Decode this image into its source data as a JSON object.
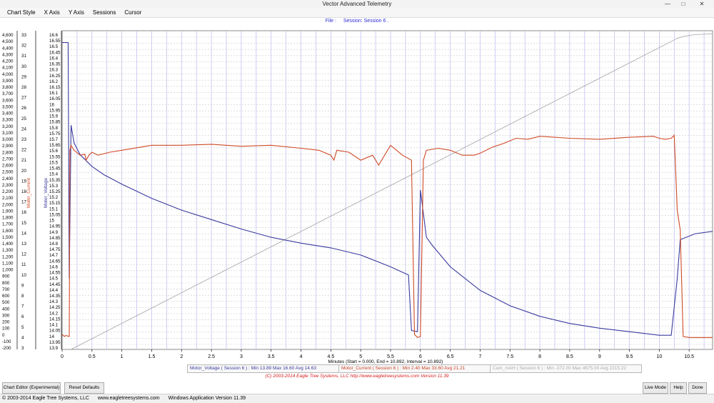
{
  "window": {
    "title": "Vector Advanced Telemetry"
  },
  "menu": [
    "Chart Style",
    "X Axis",
    "Y Axis",
    "Sessions",
    "Cursor"
  ],
  "file_bar": {
    "file": "File :",
    "session": "Session: Session 6 ."
  },
  "colors": {
    "voltage": "#3a3a9e",
    "current": "#cf4a26",
    "cum_mah": "#a0a0a0",
    "vgrid": "#b9b9f0",
    "hgrid": "#c9c9c9"
  },
  "chart_data": {
    "type": "line",
    "xlabel": "Minutes (Start = 0.000, End = 10.892, Interval = 10.892)",
    "xlim": [
      0,
      10.892
    ],
    "x_ticks": [
      0,
      0.5,
      1,
      1.5,
      2,
      2.5,
      3,
      3.5,
      4,
      4.5,
      5,
      5.5,
      6,
      6.5,
      7,
      7.5,
      8,
      8.5,
      9,
      9.5,
      10,
      10.5
    ],
    "x_tick_labels": [
      "0",
      "0.5",
      "1",
      "1.5",
      "2",
      "2.5",
      "3",
      "3.5",
      "4",
      "4.5",
      "5",
      "5.5",
      "6",
      "6.5",
      "7",
      "7.5",
      "8",
      "8.5",
      "9",
      "9.5",
      "10",
      "10.5"
    ],
    "y_axes": [
      {
        "name": "Cum_mAH",
        "min": -300,
        "max": 4700,
        "step": 100,
        "ticks": [
          "4,600",
          "4,500",
          "4,400",
          "4,300",
          "4,200",
          "4,100",
          "4,000",
          "3,900",
          "3,800",
          "3,700",
          "3,600",
          "3,500",
          "3,400",
          "3,300",
          "3,200",
          "3,100",
          "3,000",
          "2,900",
          "2,800",
          "2,700",
          "2,600",
          "2,500",
          "2,400",
          "2,300",
          "2,200",
          "2,100",
          "2,000",
          "1,900",
          "1,800",
          "1,700",
          "1,600",
          "1,500",
          "1,400",
          "1,300",
          "1,200",
          "1,100",
          "1,000",
          "900",
          "800",
          "700",
          "600",
          "500",
          "400",
          "300",
          "200",
          "100",
          "0",
          "-100",
          "-200"
        ]
      },
      {
        "name": "Motor_Current",
        "min": 2,
        "max": 34,
        "step": 1,
        "label": "Motor_Current",
        "ticks": [
          "33",
          "32",
          "31",
          "30",
          "29",
          "28",
          "27",
          "26",
          "25",
          "24",
          "23",
          "22",
          "21",
          "20",
          "19",
          "18",
          "17",
          "16",
          "15",
          "14",
          "13",
          "12",
          "11",
          "10",
          "9",
          "8",
          "7",
          "6",
          "5",
          "4",
          "3"
        ]
      },
      {
        "name": "Motor_Voltage",
        "min": 13.9,
        "max": 16.6,
        "step": 0.05,
        "label": "Motor_Voltage",
        "ticks": [
          "16.6",
          "16.55",
          "16.5",
          "16.45",
          "16.4",
          "16.35",
          "16.3",
          "16.25",
          "16.2",
          "16.15",
          "16.1",
          "16.05",
          "16",
          "15.95",
          "15.9",
          "15.85",
          "15.8",
          "15.75",
          "15.7",
          "15.65",
          "15.6",
          "15.55",
          "15.5",
          "15.45",
          "15.4",
          "15.35",
          "15.3",
          "15.25",
          "15.2",
          "15.15",
          "15.1",
          "15.05",
          "15",
          "14.95",
          "14.9",
          "14.85",
          "14.8",
          "14.75",
          "14.7",
          "14.65",
          "14.6",
          "14.55",
          "14.5",
          "14.45",
          "14.4",
          "14.35",
          "14.3",
          "14.25",
          "14.2",
          "14.15",
          "14.1",
          "14.05",
          "14",
          "13.95",
          "13.9"
        ]
      }
    ],
    "series": [
      {
        "name": "Motor_Current",
        "axis": 1,
        "x": [
          0,
          0.04,
          0.06,
          0.12,
          0.13,
          0.15,
          0.2,
          0.3,
          0.38,
          0.4,
          0.45,
          0.5,
          0.6,
          0.8,
          1,
          1.5,
          2,
          2.5,
          3,
          3.5,
          4,
          4.3,
          4.5,
          4.55,
          4.6,
          4.8,
          5,
          5.2,
          5.3,
          5.5,
          5.7,
          5.85,
          5.9,
          5.95,
          6,
          6.05,
          6.1,
          6.3,
          6.5,
          6.7,
          6.9,
          7,
          7.2,
          7.4,
          7.6,
          7.8,
          8,
          8.5,
          9,
          9.5,
          9.9,
          10,
          10.1,
          10.2,
          10.25,
          10.3,
          10.35,
          10.4,
          10.5,
          10.6,
          10.892
        ],
        "y": [
          3.5,
          3.3,
          3.4,
          3.3,
          22,
          22.5,
          22,
          21.5,
          21.6,
          21,
          21.5,
          21.8,
          21.5,
          21.8,
          22,
          22.5,
          22.5,
          22.6,
          22.4,
          22.5,
          22.2,
          22,
          21.5,
          21,
          22,
          21.8,
          21,
          21.5,
          20.5,
          22.5,
          21.5,
          21,
          3.5,
          3.2,
          3.3,
          21,
          22,
          22.2,
          22,
          21.5,
          21.5,
          21.7,
          22.3,
          22.7,
          23.2,
          23.1,
          23.4,
          23.2,
          23.1,
          23.3,
          23.4,
          23.2,
          23.1,
          23.2,
          23.5,
          16,
          14,
          3.3,
          3.2,
          3.2,
          3.2
        ]
      },
      {
        "name": "Motor_Voltage",
        "axis": 2,
        "x": [
          0,
          0.1,
          0.12,
          0.15,
          0.2,
          0.3,
          0.4,
          0.5,
          0.7,
          1,
          1.5,
          2,
          2.5,
          3,
          3.5,
          4,
          4.5,
          5,
          5.5,
          5.8,
          5.85,
          5.95,
          6,
          6.1,
          6.2,
          6.5,
          7,
          7.5,
          8,
          8.5,
          9,
          9.5,
          10,
          10.2,
          10.3,
          10.35,
          10.45,
          10.6,
          10.892
        ],
        "y": [
          16.5,
          16.5,
          14.5,
          15.8,
          15.65,
          15.55,
          15.5,
          15.45,
          15.38,
          15.3,
          15.18,
          15.08,
          15,
          14.92,
          14.85,
          14.8,
          14.76,
          14.7,
          14.6,
          14.53,
          14.06,
          14.05,
          15.25,
          14.85,
          14.78,
          14.6,
          14.4,
          14.27,
          14.18,
          14.12,
          14.08,
          14.05,
          14.02,
          14.02,
          14.5,
          14.83,
          14.85,
          14.88,
          14.9
        ]
      },
      {
        "name": "Cum_mAH",
        "axis": 0,
        "x": [
          0,
          0.15,
          10.3,
          10.4,
          10.6,
          10.892
        ],
        "y": [
          -300,
          -300,
          4580,
          4610,
          4640,
          4650
        ]
      }
    ]
  },
  "legend": {
    "voltage": "Motor_Voltage ( Session 6 ) : Min 13.89  Max 16.60  Avg 14.63",
    "current": "Motor_Current ( Session 6 ) : Min 2.40  Max 33.60  Avg 21.21",
    "cum_mah": "Cum_mAH ( Session 6 ) : Min -372.00  Max 4675.00  Avg 2215.22"
  },
  "copyright": "(C) 2003-2014 Eagle Tree Systems, LLC  http://www.eagletreesystems.com  Version 11.39",
  "buttons": {
    "chart_editor": "Chart Editor (Experimental)",
    "reset_defaults": "Reset Defaults",
    "live_mode": "Live Mode",
    "help": "Help",
    "done": "Done"
  },
  "status": {
    "copyright": "© 2003-2014 Eagle Tree Systems, LLC",
    "url": "www.eagletreesystems.com",
    "version": "Windows Application Version 11.39"
  }
}
